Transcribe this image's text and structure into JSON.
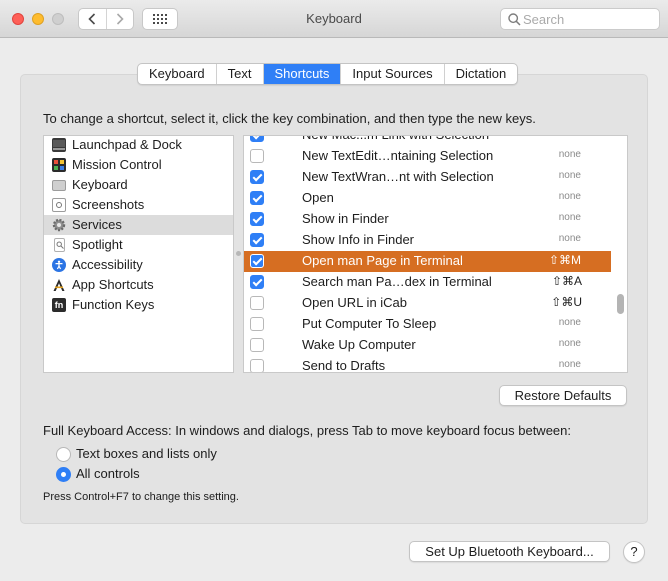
{
  "window": {
    "title": "Keyboard",
    "search_placeholder": "Search"
  },
  "tabs": [
    {
      "label": "Keyboard",
      "active": false
    },
    {
      "label": "Text",
      "active": false
    },
    {
      "label": "Shortcuts",
      "active": true
    },
    {
      "label": "Input Sources",
      "active": false
    },
    {
      "label": "Dictation",
      "active": false
    }
  ],
  "instruction": "To change a shortcut, select it, click the key combination, and then type the new keys.",
  "categories": [
    {
      "label": "Launchpad & Dock",
      "icon": "launchpad-icon",
      "selected": false
    },
    {
      "label": "Mission Control",
      "icon": "mission-control-icon",
      "selected": false
    },
    {
      "label": "Keyboard",
      "icon": "keyboard-icon",
      "selected": false
    },
    {
      "label": "Screenshots",
      "icon": "screenshots-icon",
      "selected": false
    },
    {
      "label": "Services",
      "icon": "gear-icon",
      "selected": true
    },
    {
      "label": "Spotlight",
      "icon": "spotlight-icon",
      "selected": false
    },
    {
      "label": "Accessibility",
      "icon": "accessibility-icon",
      "selected": false
    },
    {
      "label": "App Shortcuts",
      "icon": "app-shortcuts-icon",
      "selected": false
    },
    {
      "label": "Function Keys",
      "icon": "function-keys-icon",
      "selected": false
    }
  ],
  "shortcuts": [
    {
      "label": "New Mac...m Link with Selection",
      "checked": true,
      "key": "none",
      "selected": false
    },
    {
      "label": "New TextEdit…ntaining Selection",
      "checked": false,
      "key": "none",
      "selected": false
    },
    {
      "label": "New TextWran…nt with Selection",
      "checked": true,
      "key": "none",
      "selected": false
    },
    {
      "label": "Open",
      "checked": true,
      "key": "none",
      "selected": false
    },
    {
      "label": "Show in Finder",
      "checked": true,
      "key": "none",
      "selected": false
    },
    {
      "label": "Show Info in Finder",
      "checked": true,
      "key": "none",
      "selected": false
    },
    {
      "label": "Open man Page in Terminal",
      "checked": true,
      "key": "⇧⌘M",
      "selected": true
    },
    {
      "label": "Search man Pa…dex in Terminal",
      "checked": true,
      "key": "⇧⌘A",
      "selected": false
    },
    {
      "label": "Open URL in iCab",
      "checked": false,
      "key": "⇧⌘U",
      "selected": false
    },
    {
      "label": "Put Computer To Sleep",
      "checked": false,
      "key": "none",
      "selected": false
    },
    {
      "label": "Wake Up Computer",
      "checked": false,
      "key": "none",
      "selected": false
    },
    {
      "label": "Send to Drafts",
      "checked": false,
      "key": "none",
      "selected": false
    }
  ],
  "restore_defaults": "Restore Defaults",
  "full_keyboard_access": {
    "label": "Full Keyboard Access: In windows and dialogs, press Tab to move keyboard focus between:",
    "options": [
      {
        "label": "Text boxes and lists only",
        "selected": false
      },
      {
        "label": "All controls",
        "selected": true
      }
    ],
    "hint": "Press Control+F7 to change this setting."
  },
  "bluetooth_button": "Set Up Bluetooth Keyboard...",
  "help_button": "?",
  "colors": {
    "accent": "#2f7ff6",
    "selection": "#d66e22"
  }
}
